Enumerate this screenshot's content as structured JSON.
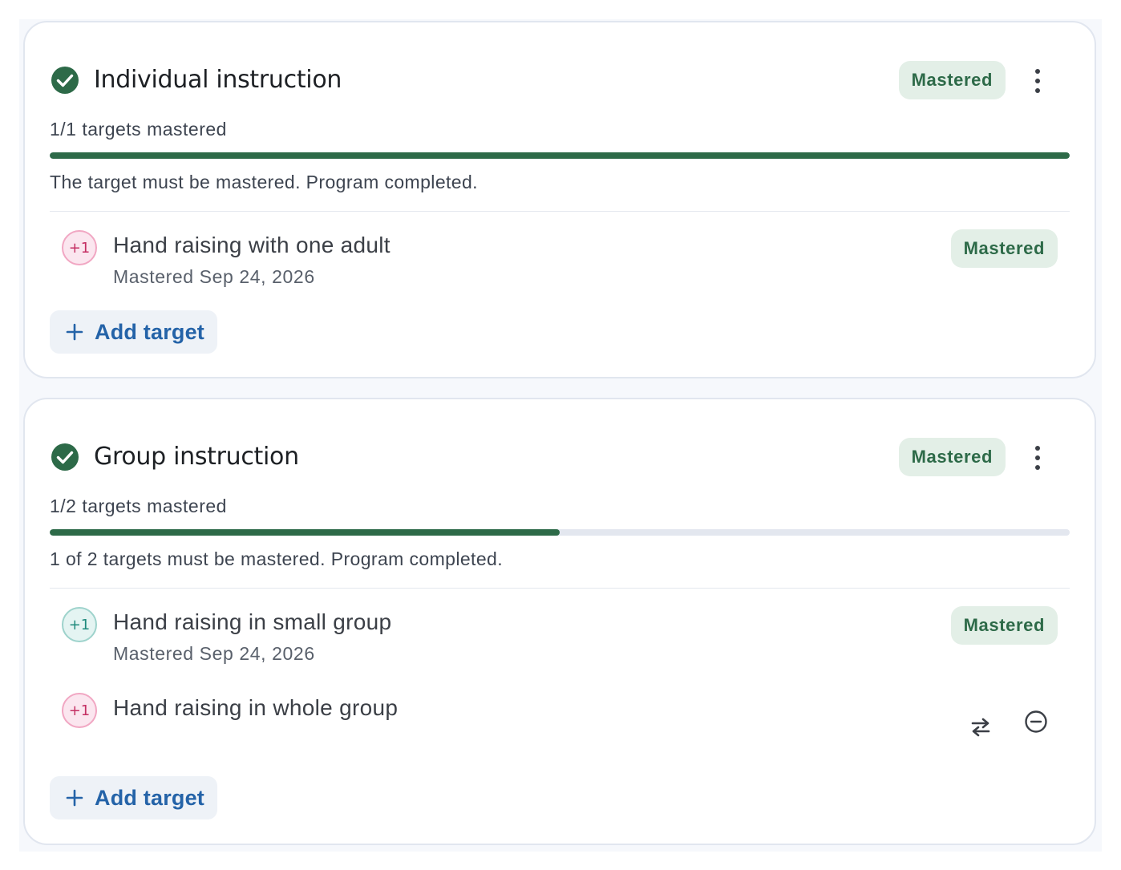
{
  "programs": [
    {
      "title": "Individual instruction",
      "status": "Mastered",
      "progress_label": "1/1 targets mastered",
      "progress_fraction": 1.0,
      "criteria": "The target must be mastered. Program completed.",
      "targets": [
        {
          "badge": "+1",
          "badge_color": "pink",
          "name": "Hand raising with one adult",
          "subtitle": "Mastered Sep 24, 2026",
          "status": "Mastered"
        }
      ],
      "add_label": "Add target"
    },
    {
      "title": "Group instruction",
      "status": "Mastered",
      "progress_label": "1/2 targets mastered",
      "progress_fraction": 0.5,
      "criteria": "1 of 2 targets must be mastered. Program completed.",
      "targets": [
        {
          "badge": "+1",
          "badge_color": "teal",
          "name": "Hand raising in small group",
          "subtitle": "Mastered Sep 24, 2026",
          "status": "Mastered"
        },
        {
          "badge": "+1",
          "badge_color": "pink",
          "name": "Hand raising in whole group",
          "icons": [
            "swap-icon",
            "remove-icon"
          ]
        }
      ],
      "add_label": "Add target"
    }
  ],
  "colors": {
    "accent_green": "#2d6a48",
    "link_blue": "#2463a8",
    "pill_bg": "#e3efe7"
  }
}
